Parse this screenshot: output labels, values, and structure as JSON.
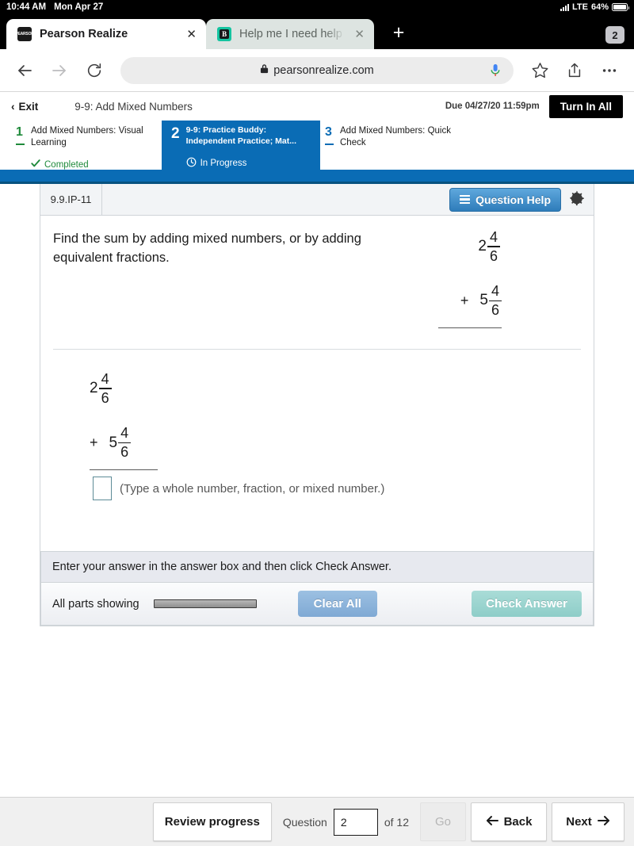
{
  "status_bar": {
    "time": "10:44 AM",
    "date": "Mon Apr 27",
    "network": "LTE",
    "battery": "64%",
    "signal_icon": "signal-bars-icon",
    "battery_icon": "battery-icon"
  },
  "browser": {
    "tabs": [
      {
        "title": "Pearson Realize",
        "favicon": "pearson-favicon",
        "close_label": "✕",
        "active": true
      },
      {
        "title": "Help me I need help - Brainly",
        "favicon": "brainly-favicon",
        "close_label": "✕",
        "active": false
      }
    ],
    "new_tab_label": "+",
    "tab_count": "2",
    "toolbar": {
      "back_icon": "back-arrow-icon",
      "forward_icon": "forward-arrow-icon",
      "reload_icon": "reload-icon",
      "lock_icon": "lock-icon",
      "url": "pearsonrealize.com",
      "mic_icon": "microphone-icon",
      "bookmark_icon": "star-icon",
      "share_icon": "share-icon",
      "more_icon": "more-options-icon"
    }
  },
  "pearson_header": {
    "exit_label": "Exit",
    "back_chevron": "‹",
    "assignment_title": "9-9: Add Mixed Numbers",
    "due": "Due 04/27/20 11:59pm",
    "turn_in_label": "Turn In All"
  },
  "steps": [
    {
      "number": "1",
      "label": "Add Mixed Numbers: Visual Learning",
      "status": "Completed",
      "status_icon": "check-icon"
    },
    {
      "number": "2",
      "label": "9-9: Practice Buddy: Independent Practice; Mat...",
      "status": "In Progress",
      "status_icon": "clock-icon"
    },
    {
      "number": "3",
      "label": "Add Mixed Numbers: Quick Check",
      "status": "",
      "status_icon": ""
    }
  ],
  "question": {
    "id": "9.9.IP-11",
    "help_label": "Question Help",
    "help_icon": "list-icon",
    "settings_icon": "gear-icon",
    "prompt": "Find the sum by adding mixed numbers, or by adding equivalent fractions.",
    "problem": {
      "addend1": {
        "whole": "2",
        "numerator": "4",
        "denominator": "6"
      },
      "addend2": {
        "whole": "5",
        "numerator": "4",
        "denominator": "6"
      },
      "operator": "+"
    },
    "answer_box_value": "",
    "answer_hint": "(Type a whole number, fraction, or mixed number.)"
  },
  "answer_footer": {
    "message": "Enter your answer in the answer box and then click Check Answer.",
    "parts_label": "All parts showing",
    "clear_label": "Clear All",
    "check_label": "Check Answer"
  },
  "bottom_nav": {
    "review_label": "Review progress",
    "question_label": "Question",
    "question_value": "2",
    "of_label": "of 12",
    "go_label": "Go",
    "back_label": "Back",
    "back_icon": "arrow-left-icon",
    "next_label": "Next",
    "next_icon": "arrow-right-icon"
  },
  "colors": {
    "pearson_blue": "#0a6cb5",
    "completed_green": "#1f8a3b",
    "help_blue": "#2e7cba",
    "answer_border_teal": "#5d8b97",
    "check_button_teal": "#8ecdc8",
    "clear_button_blue": "#7fa9d4"
  }
}
